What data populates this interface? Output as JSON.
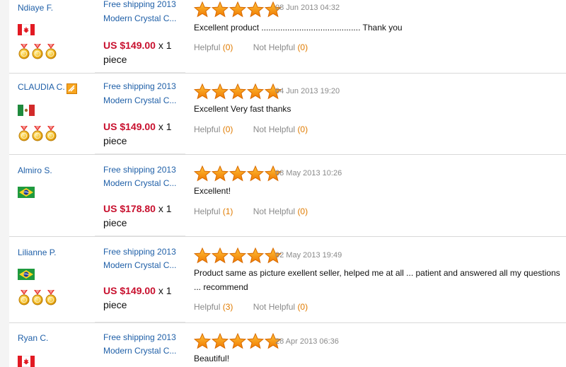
{
  "reviews": [
    {
      "user": "Ndiaye F.",
      "flag": "canada-flag-icon",
      "verified_badge": false,
      "medals": 3,
      "product_line1": "Free shipping 2013",
      "product_line2": "Modern Crystal C...",
      "price": "US $149.00",
      "quantity": "x 1",
      "unit": "piece",
      "rating": 5,
      "date": "08 Jun 2013 04:32",
      "comment": "Excellent product .......................................... Thank you",
      "helpful_label": "Helpful",
      "helpful_count": "(0)",
      "not_helpful_label": "Not Helpful",
      "not_helpful_count": "(0)"
    },
    {
      "user": "CLAUDIA C.",
      "flag": "mexico-flag-icon",
      "verified_badge": true,
      "medals": 3,
      "product_line1": "Free shipping 2013",
      "product_line2": "Modern Crystal C...",
      "price": "US $149.00",
      "quantity": "x 1",
      "unit": "piece",
      "rating": 5,
      "date": "04 Jun 2013 19:20",
      "comment": "Excellent Very fast thanks",
      "helpful_label": "Helpful",
      "helpful_count": "(0)",
      "not_helpful_label": "Not Helpful",
      "not_helpful_count": "(0)"
    },
    {
      "user": "Almiro S.",
      "flag": "brazil-flag-icon",
      "verified_badge": false,
      "medals": 0,
      "product_line1": "Free shipping 2013",
      "product_line2": "Modern Crystal C...",
      "price": "US $178.80",
      "quantity": "x 1",
      "unit": "piece",
      "rating": 5,
      "date": "08 May 2013 10:26",
      "comment": "Excellent!",
      "helpful_label": "Helpful",
      "helpful_count": "(1)",
      "not_helpful_label": "Not Helpful",
      "not_helpful_count": "(0)"
    },
    {
      "user": "Lilianne P.",
      "flag": "brazil-flag-icon",
      "verified_badge": false,
      "medals": 3,
      "product_line1": "Free shipping 2013",
      "product_line2": "Modern Crystal C...",
      "price": "US $149.00",
      "quantity": "x 1",
      "unit": "piece",
      "rating": 5,
      "date": "02 May 2013 19:49",
      "comment": "Product same as picture exellent seller, helped me at all ... patient and answered all my questions ... recommend",
      "helpful_label": "Helpful",
      "helpful_count": "(3)",
      "not_helpful_label": "Not Helpful",
      "not_helpful_count": "(0)"
    },
    {
      "user": "Ryan C.",
      "flag": "canada-flag-icon",
      "verified_badge": false,
      "medals": 0,
      "product_line1": "Free shipping 2013",
      "product_line2": "Modern Crystal C...",
      "rating": 5,
      "date": "28 Apr 2013 06:36",
      "comment": "Beautiful!"
    }
  ]
}
